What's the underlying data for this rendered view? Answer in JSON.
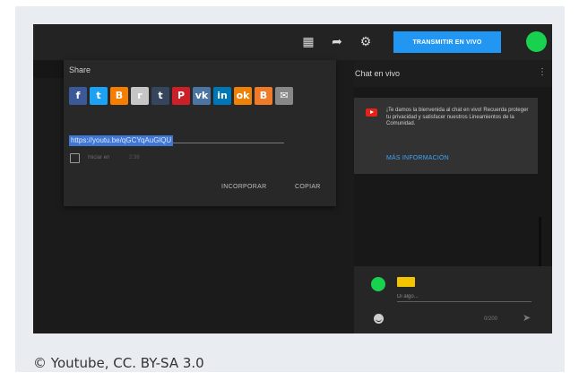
{
  "topbar": {
    "icons": [
      "clapperboard-icon",
      "share-arrow-icon",
      "gear-icon"
    ],
    "live_button": "TRANSMITIR EN VIVO"
  },
  "share": {
    "title": "Share",
    "social": [
      {
        "name": "facebook",
        "glyph": "f",
        "color": "#3b5998"
      },
      {
        "name": "twitter",
        "glyph": "t",
        "color": "#1da1f2"
      },
      {
        "name": "blogger",
        "glyph": "B",
        "color": "#f57d00"
      },
      {
        "name": "reddit",
        "glyph": "r",
        "color": "#c6c6c6"
      },
      {
        "name": "tumblr",
        "glyph": "t",
        "color": "#35465c"
      },
      {
        "name": "pinterest",
        "glyph": "P",
        "color": "#cb2027"
      },
      {
        "name": "vk",
        "glyph": "vk",
        "color": "#4c75a3"
      },
      {
        "name": "linkedin",
        "glyph": "in",
        "color": "#0077b5"
      },
      {
        "name": "odnoklassniki",
        "glyph": "ok",
        "color": "#ee8208"
      },
      {
        "name": "blogger-alt",
        "glyph": "B",
        "color": "#ee7a2a"
      },
      {
        "name": "email",
        "glyph": "✉",
        "color": "#888888"
      }
    ],
    "url": "https://youtu.be/qGCYqAuGlQU",
    "start_label": "Iniciar en",
    "start_time": "2:36",
    "embed_label": "INCORPORAR",
    "copy_label": "COPIAR"
  },
  "chat": {
    "title": "Chat en vivo",
    "menu_glyph": "⋮",
    "welcome_text": "¡Te damos la bienvenida al chat en vivo! Recuerda proteger tu privacidad y satisfacer nuestros Lineamientos de la Comunidad.",
    "more_info": "MÁS INFORMACIÓN",
    "placeholder": "Di algo...",
    "counter": "0/200"
  },
  "caption": "© Youtube, CC. BY-SA 3.0"
}
